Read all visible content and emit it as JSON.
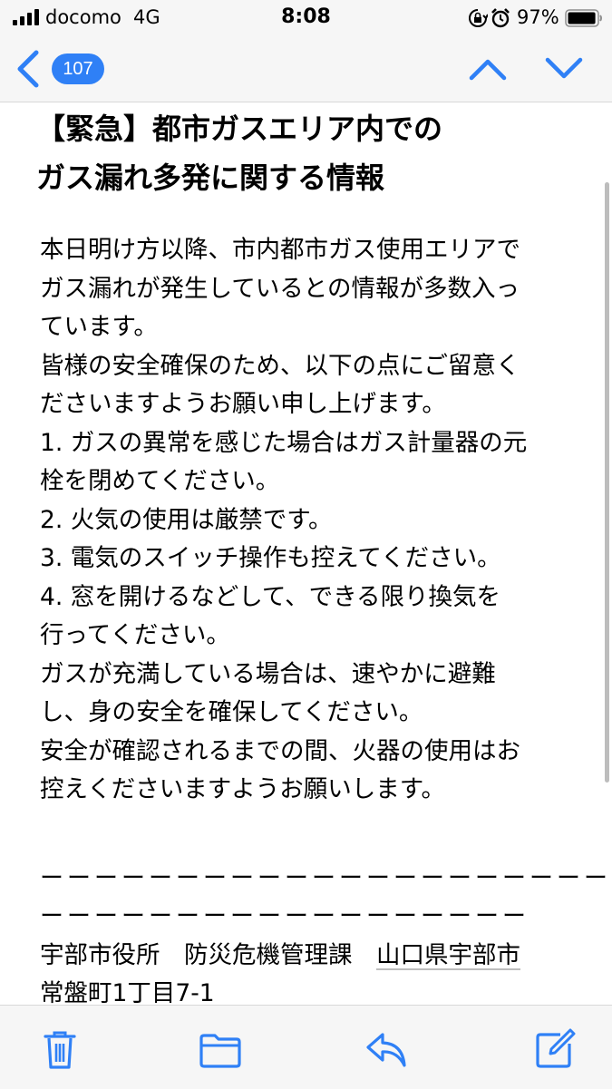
{
  "status_bar": {
    "carrier": "docomo",
    "network": "4G",
    "time": "8:08",
    "battery_text": "97%",
    "battery_level": 0.97,
    "icons": [
      "signal-icon",
      "orientation-lock-icon",
      "alarm-icon",
      "battery-icon"
    ]
  },
  "nav": {
    "back_icon": "chevron-left-icon",
    "message_count": "107",
    "prev_icon": "chevron-up-icon",
    "next_icon": "chevron-down-icon",
    "accent_color": "#2f80f6"
  },
  "email": {
    "subject_lines": [
      "【緊急】都市ガスエリア内での",
      "ガス漏れ多発に関する情報"
    ],
    "body_lines": [
      "本日明け方以降、市内都市ガス使用エリアで",
      "ガス漏れが発生しているとの情報が多数入っ",
      "ています。",
      "皆様の安全確保のため、以下の点にご留意く",
      "ださいますようお願い申し上げます。",
      "1.  ガスの異常を感じた場合はガス計量器の元",
      "栓を閉めてください。",
      "2.  火気の使用は厳禁です。",
      "3.  電気のスイッチ操作も控えてください。",
      "4.  窓を開けるなどして、できる限り換気を",
      "行ってください。",
      "ガスが充満している場合は、速やかに避難",
      "し、身の安全を確保してください。",
      "安全が確認されるまでの間、火器の使用はお",
      "控えくださいますようお願いします。"
    ],
    "divider_lines": [
      "ーーーーーーーーーーーーーーーーーーーーーーーー",
      "ーーーーーーーーーーーーーーーーーー"
    ],
    "signature_line1_prefix": "宇部市役所　防災危機管理課　",
    "signature_line1_address": "山口県宇部市",
    "signature_line2": "常盤町1丁目7-1"
  },
  "toolbar": {
    "icons": [
      "trash-icon",
      "folder-icon",
      "reply-icon",
      "compose-icon"
    ],
    "accent_color": "#2f80f6"
  }
}
